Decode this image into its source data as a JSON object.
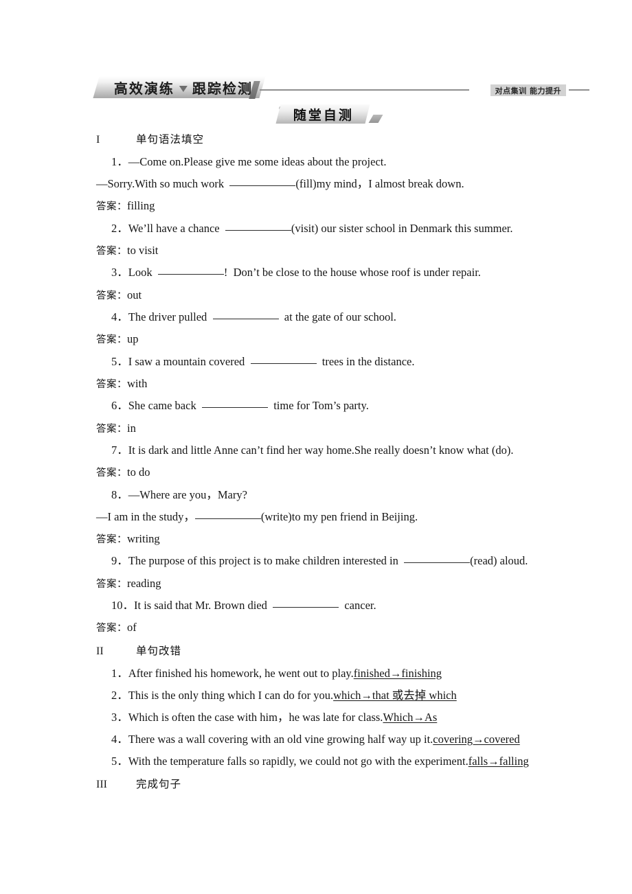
{
  "header": {
    "left_banner_title_a": "高效演练",
    "left_banner_separator": "triangle-down-icon",
    "left_banner_title_b": "跟踪检测",
    "right_badge": "对点集训 能力提升"
  },
  "section_title": "随堂自测",
  "answer_prefix": "答案：",
  "sections": [
    {
      "num": "I",
      "label": "单句语法填空",
      "items": [
        {
          "lines": [
            {
              "kind": "q",
              "indent": true,
              "parts": [
                {
                  "t": "1．—Come on.Please give me some ideas about the project."
                }
              ]
            },
            {
              "kind": "q",
              "parts": [
                {
                  "t": "—Sorry.With so much work  "
                },
                {
                  "blank": "w1"
                },
                {
                  "t": "(fill)my mind，I almost break down."
                }
              ]
            }
          ],
          "answer": "filling"
        },
        {
          "lines": [
            {
              "kind": "q",
              "indent": true,
              "parts": [
                {
                  "t": "2．We’ll have a chance  "
                },
                {
                  "blank": "w1"
                },
                {
                  "t": "(visit) our sister school in Denmark this summer."
                }
              ]
            }
          ],
          "answer": "to visit"
        },
        {
          "lines": [
            {
              "kind": "q",
              "indent": true,
              "parts": [
                {
                  "t": "3．Look  "
                },
                {
                  "blank": "w1"
                },
                {
                  "t": "!  Don’t be close to the house whose roof is under repair."
                }
              ]
            }
          ],
          "answer": "out"
        },
        {
          "lines": [
            {
              "kind": "q",
              "indent": true,
              "parts": [
                {
                  "t": "4．The driver pulled  "
                },
                {
                  "blank": "w1"
                },
                {
                  "t": "  at the gate of our school."
                }
              ]
            }
          ],
          "answer": "up"
        },
        {
          "lines": [
            {
              "kind": "q",
              "indent": true,
              "parts": [
                {
                  "t": "5．I saw a mountain covered  "
                },
                {
                  "blank": "w1"
                },
                {
                  "t": "  trees in the distance."
                }
              ]
            }
          ],
          "answer": "with"
        },
        {
          "lines": [
            {
              "kind": "q",
              "indent": true,
              "parts": [
                {
                  "t": "6．She came back  "
                },
                {
                  "blank": "w1"
                },
                {
                  "t": "  time for Tom’s party."
                }
              ]
            }
          ],
          "answer": "in"
        },
        {
          "lines": [
            {
              "kind": "q",
              "justify": true,
              "indent": true,
              "parts": [
                {
                  "t": "7．It is dark and little Anne can’t find her way home.She really doesn’t know what (do)."
                }
              ]
            }
          ],
          "answer": "to do"
        },
        {
          "lines": [
            {
              "kind": "q",
              "indent": true,
              "parts": [
                {
                  "t": "8．—Where are you，Mary?"
                }
              ]
            },
            {
              "kind": "q",
              "parts": [
                {
                  "t": "—I am in the study，"
                },
                {
                  "blank": "w1"
                },
                {
                  "t": "(write)to my pen friend in Beijing."
                }
              ]
            }
          ],
          "answer": "writing"
        },
        {
          "lines": [
            {
              "kind": "q",
              "indent": true,
              "parts": [
                {
                  "t": "9．The purpose of this project is to make children interested in  "
                },
                {
                  "blank": "w1"
                },
                {
                  "t": "(read) aloud."
                }
              ]
            }
          ],
          "answer": "reading"
        },
        {
          "lines": [
            {
              "kind": "q",
              "indent": true,
              "parts": [
                {
                  "t": "10．It is said that Mr. Brown died  "
                },
                {
                  "blank": "w1"
                },
                {
                  "t": "  cancer."
                }
              ]
            }
          ],
          "answer": "of"
        }
      ]
    },
    {
      "num": "II",
      "label": "单句改错",
      "items": [
        {
          "lines": [
            {
              "kind": "q",
              "indent": true,
              "parts": [
                {
                  "t": "1．After finished his homework, he went out to play."
                },
                {
                  "corr": "finished→finishing"
                }
              ]
            }
          ]
        },
        {
          "lines": [
            {
              "kind": "q",
              "indent": true,
              "parts": [
                {
                  "t": "2．This is the only thing which I can do for you."
                },
                {
                  "corr": "which→that 或去掉 which"
                }
              ]
            }
          ]
        },
        {
          "lines": [
            {
              "kind": "q",
              "indent": true,
              "parts": [
                {
                  "t": "3．Which is often the case with him，he was late for class."
                },
                {
                  "corr": "Which→As"
                }
              ]
            }
          ]
        },
        {
          "lines": [
            {
              "kind": "q",
              "indent": true,
              "parts": [
                {
                  "t": "4．There was a wall covering with an old vine growing half way up it."
                },
                {
                  "corr": "covering→covered"
                }
              ]
            }
          ]
        },
        {
          "lines": [
            {
              "kind": "q",
              "indent": true,
              "parts": [
                {
                  "t": "5．With the temperature falls so rapidly, we could not go with the experiment."
                },
                {
                  "corr": "falls→falling"
                }
              ]
            }
          ]
        }
      ]
    },
    {
      "num": "III",
      "label": "完成句子",
      "items": []
    }
  ]
}
